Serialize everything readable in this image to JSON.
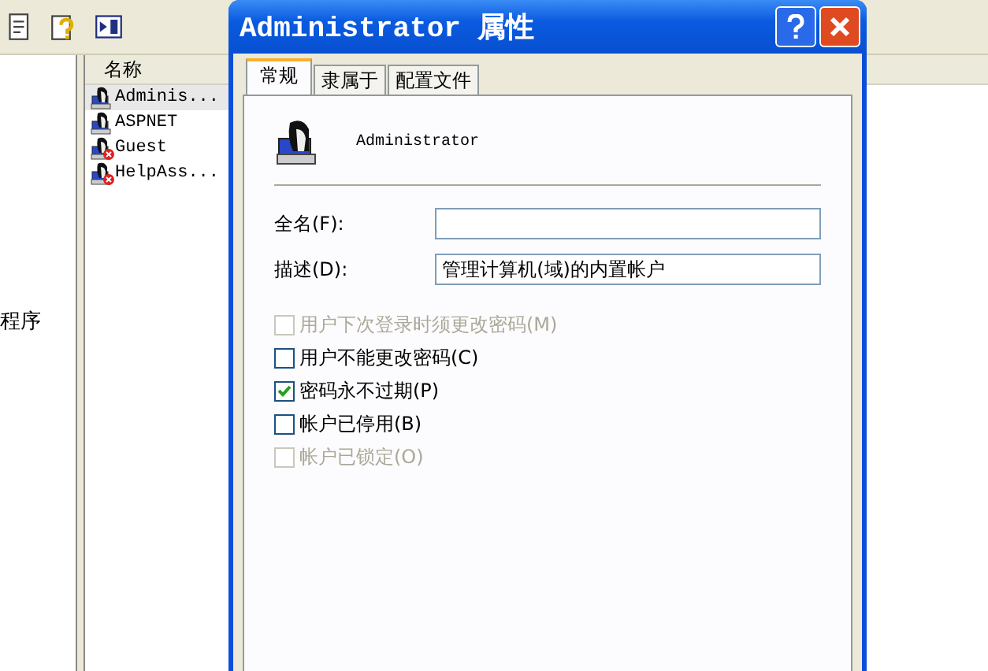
{
  "tree": {
    "items": [
      {
        "label": "程序"
      }
    ]
  },
  "list": {
    "columns": [
      "名称"
    ],
    "rows": [
      {
        "name": "Adminis...",
        "selected": true,
        "disabled": false
      },
      {
        "name": "ASPNET",
        "selected": false,
        "disabled": false
      },
      {
        "name": "Guest",
        "selected": false,
        "disabled": true
      },
      {
        "name": "HelpAss...",
        "selected": false,
        "disabled": true
      }
    ]
  },
  "dialog": {
    "title": "Administrator 属性",
    "tabs": [
      {
        "label": "常规",
        "selected": true
      },
      {
        "label": "隶属于",
        "selected": false
      },
      {
        "label": "配置文件",
        "selected": false
      }
    ],
    "user_name": "Administrator",
    "fields": [
      {
        "label": "全名(F):"
      },
      {
        "label": "描述(D):",
        "value": "管理计算机(域)的内置帐户"
      }
    ],
    "checkboxes": [
      {
        "label": "用户下次登录时须更改密码(M)",
        "checked": false,
        "disabled": true
      },
      {
        "label": "用户不能更改密码(C)",
        "checked": false,
        "disabled": false
      },
      {
        "label": "密码永不过期(P)",
        "checked": true,
        "disabled": false
      },
      {
        "label": "帐户已停用(B)",
        "checked": false,
        "disabled": false
      },
      {
        "label": "帐户已锁定(O)",
        "checked": false,
        "disabled": true
      }
    ]
  }
}
